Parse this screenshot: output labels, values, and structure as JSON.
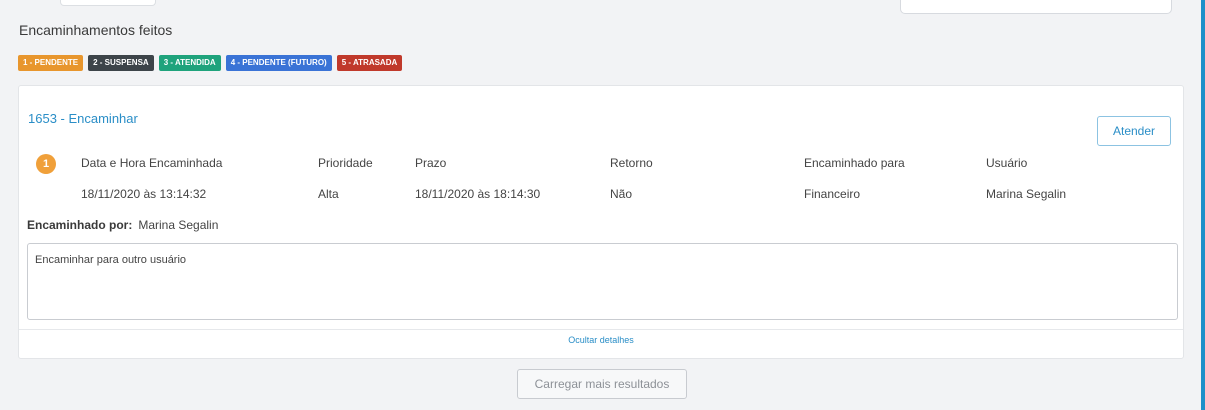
{
  "section_title": "Encaminhamentos feitos",
  "legend": [
    {
      "label": "1 - PENDENTE",
      "color": "#e8962d"
    },
    {
      "label": "2 - SUSPENSA",
      "color": "#3d4449"
    },
    {
      "label": "3 - ATENDIDA",
      "color": "#1fa37c"
    },
    {
      "label": "4 - PENDENTE (FUTURO)",
      "color": "#3a73d6"
    },
    {
      "label": "5 - ATRASADA",
      "color": "#c0392b"
    }
  ],
  "card": {
    "title": "1653 - Encaminhar",
    "attend_button": "Atender",
    "step_number": "1",
    "columns": {
      "date": {
        "header": "Data e Hora Encaminhada",
        "value": "18/11/2020 às 13:14:32"
      },
      "priority": {
        "header": "Prioridade",
        "value": "Alta"
      },
      "deadline": {
        "header": "Prazo",
        "value": "18/11/2020 às 18:14:30"
      },
      "return": {
        "header": "Retorno",
        "value": "Não"
      },
      "forwarded_to": {
        "header": "Encaminhado para",
        "value": "Financeiro"
      },
      "user": {
        "header": "Usuário",
        "value": "Marina Segalin"
      }
    },
    "forwarded_by_label": "Encaminhado por:",
    "forwarded_by_value": "Marina Segalin",
    "notes": "Encaminhar para outro usuário",
    "hide_details": "Ocultar detalhes"
  },
  "load_more": "Carregar mais resultados"
}
